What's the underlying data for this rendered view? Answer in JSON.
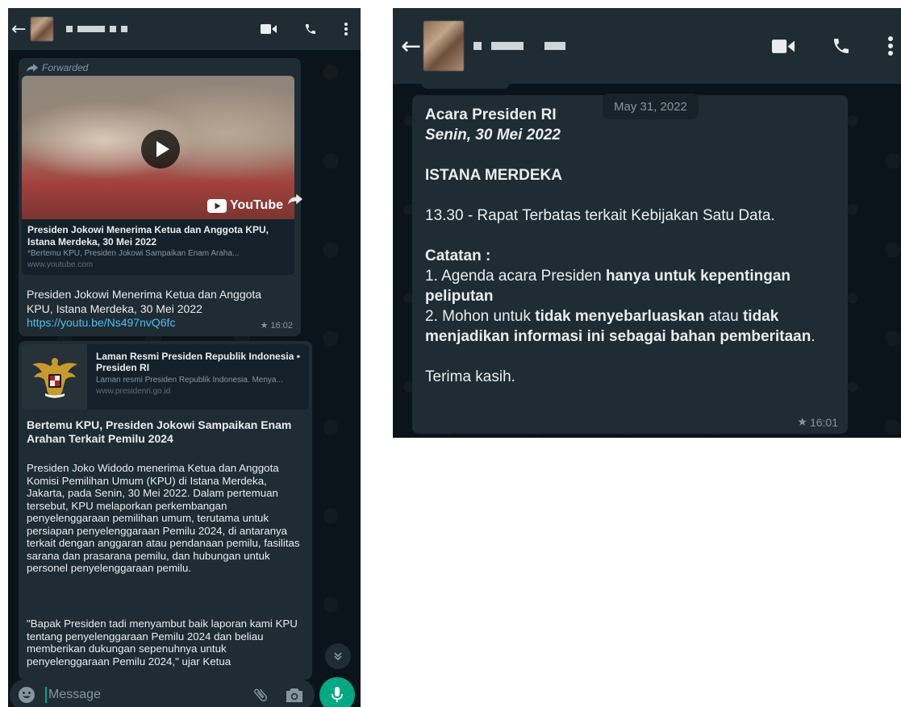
{
  "left": {
    "forwarded_label": "Forwarded",
    "video_card": {
      "brand": "YouTube",
      "title": "Presiden Jokowi Menerima Ketua dan Anggota KPU, Istana Merdeka, 30 Mei 2022",
      "description": "*Bertemu KPU, Presiden Jokowi Sampaikan Enam Araha...",
      "domain": "www.youtube.com"
    },
    "msg1": {
      "text": "Presiden Jokowi Menerima Ketua dan Anggota KPU, Istana Merdeka, 30 Mei 2022",
      "url": "https://youtu.be/Ns497nvQ6fc",
      "time": "16:02"
    },
    "site_card": {
      "title": "Laman Resmi Presiden Republik Indonesia • Presiden RI",
      "description": "Laman resmi Presiden Republik Indonesia. Menya...",
      "domain": "www.presidenri.go.id"
    },
    "msg2": {
      "heading": "Bertemu KPU, Presiden Jokowi Sampaikan Enam Arahan Terkait Pemilu 2024",
      "para1": "Presiden Joko Widodo menerima Ketua dan Anggota Komisi Pemilihan Umum (KPU) di Istana Merdeka, Jakarta, pada Senin, 30 Mei 2022. Dalam pertemuan tersebut, KPU melaporkan perkembangan penyelenggaraan pemilihan umum, terutama untuk persiapan penyelenggaraan Pemilu 2024, di antaranya terkait dengan anggaran atau pendanaan pemilu, fasilitas sarana dan prasarana pemilu, dan hubungan untuk personel penyelenggaraan pemilu.",
      "para2": "\"Bapak Presiden tadi menyambut baik laporan kami KPU tentang penyelenggaraan Pemilu 2024 dan beliau memberikan dukungan sepenuhnya untuk penyelenggaraan Pemilu 2024,\" ujar Ketua"
    },
    "input_placeholder": "Message"
  },
  "right": {
    "date_chip": "May 31, 2022",
    "line1": "Acara Presiden RI",
    "line2": "Senin, 30 Mei 2022",
    "venue": "ISTANA MERDEKA",
    "agenda": "13.30 - Rapat Terbatas terkait Kebijakan Satu Data.",
    "note_heading": "Catatan :",
    "note1_pre": "1. Agenda acara Presiden ",
    "note1_bold": "hanya untuk kepentingan peliputan",
    "note2_pre": "2. Mohon untuk ",
    "note2_bold1": "tidak menyebarluaskan",
    "note2_mid": " atau ",
    "note2_bold2": "tidak menjadikan informasi ini sebagai bahan pemberitaan",
    "note2_end": ".",
    "closing": "Terima kasih.",
    "time": "16:01"
  },
  "colors": {
    "chat_bg": "#0b141a",
    "bar_bg": "#1f2c34",
    "bubble_bg": "#1f2c34",
    "link": "#53bdeb",
    "accent": "#00a884"
  }
}
